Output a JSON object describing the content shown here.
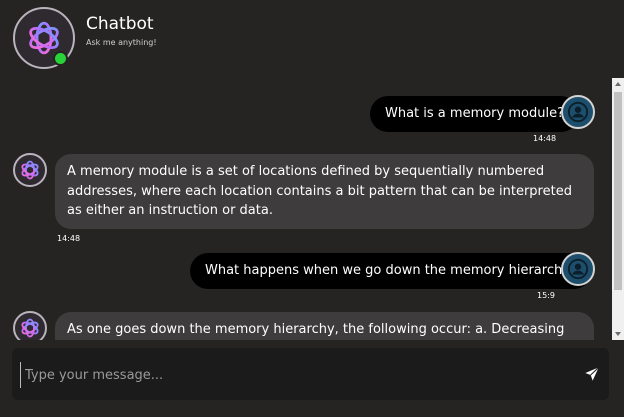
{
  "header": {
    "title": "Chatbot",
    "subtitle": "Ask me anything!",
    "avatar_icon": "openai-logo-icon",
    "status_color": "#2ad23a"
  },
  "messages": [
    {
      "sender": "user",
      "text": "What is a memory module?",
      "time": "14:48"
    },
    {
      "sender": "bot",
      "text": "A memory module is a set of locations defined by sequentially numbered addresses, where each location contains a bit pattern that can be interpreted as either an instruction or data.",
      "time": "14:48"
    },
    {
      "sender": "user",
      "text": "What happens when we go down the memory hierarchy?",
      "time": "15:9"
    },
    {
      "sender": "bot",
      "text": "As one goes down the memory hierarchy, the following occur: a. Decreasing cost per"
    }
  ],
  "composer": {
    "placeholder": "Type your message...",
    "send_icon": "send-icon"
  },
  "colors": {
    "background": "#262323",
    "user_bubble": "#000000",
    "bot_bubble": "#3e3c3c",
    "user_avatar": "#1d4e6b"
  }
}
